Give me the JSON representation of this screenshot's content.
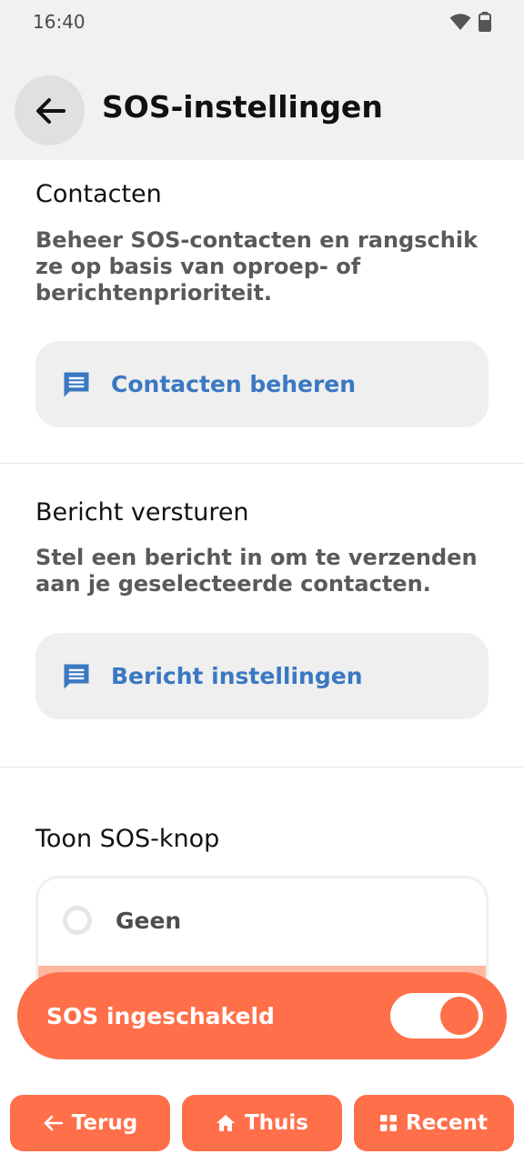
{
  "status": {
    "time": "16:40"
  },
  "header": {
    "title": "SOS-instellingen"
  },
  "sections": {
    "contacts": {
      "title": "Contacten",
      "description": "Beheer SOS-contacten en rangschik ze op basis van oproep- of berichtenprioriteit.",
      "action_label": "Contacten beheren"
    },
    "message": {
      "title": "Bericht versturen",
      "description": "Stel een bericht in om te verzenden aan je geselecteerde contacten.",
      "action_label": "Bericht instellingen"
    },
    "show_button": {
      "title": "Toon SOS-knop",
      "options": [
        "Geen"
      ],
      "selected": null
    }
  },
  "sos": {
    "label": "SOS ingeschakeld",
    "enabled": true
  },
  "nav": {
    "back": "Terug",
    "home": "Thuis",
    "recent": "Recent"
  },
  "colors": {
    "accent": "#ff6f49",
    "link": "#3a78c2",
    "header_bg": "#f1f1f1"
  }
}
